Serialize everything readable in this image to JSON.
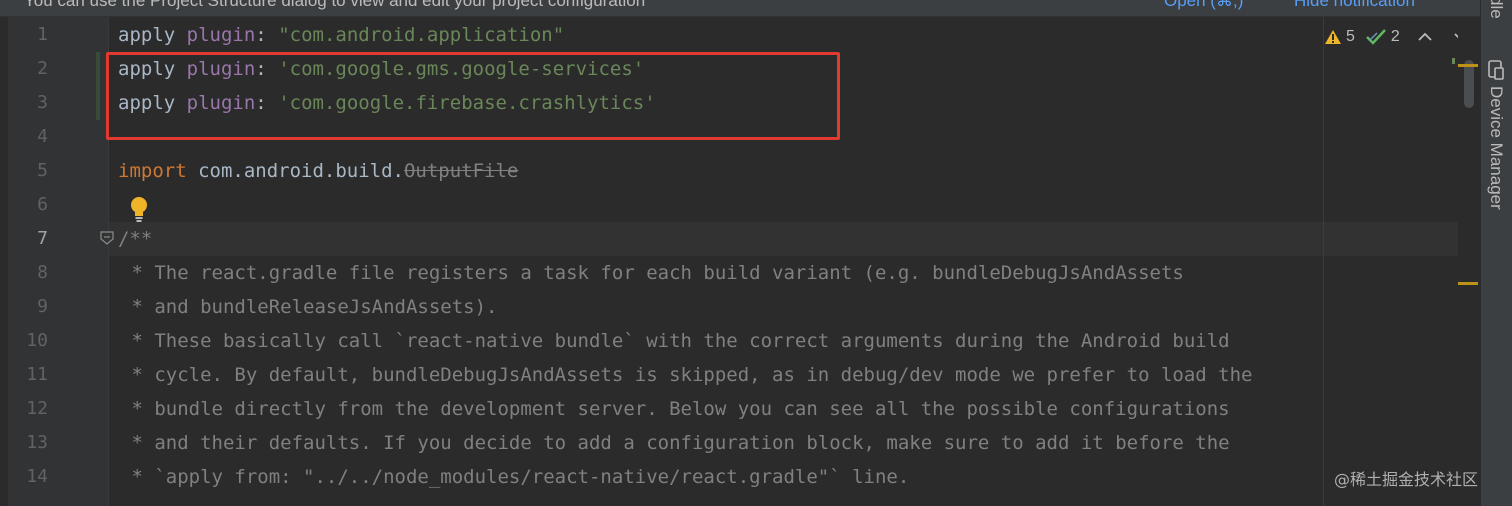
{
  "notification": {
    "message": "You can use the Project Structure dialog to view and edit your project configuration",
    "open_link": "Open (⌘;)",
    "hide_link": "Hide notification"
  },
  "side_panel": {
    "top_label": "dle",
    "device_manager_label": "Device Manager"
  },
  "inspections": {
    "warnings": "5",
    "weak_warnings": "2"
  },
  "line_numbers": [
    "1",
    "2",
    "3",
    "4",
    "5",
    "6",
    "7",
    "8",
    "9",
    "10",
    "11",
    "12",
    "13",
    "14"
  ],
  "code": {
    "l1": {
      "apply": "apply",
      "plugin": "plugin",
      "colon": ": ",
      "value": "\"com.android.application\""
    },
    "l2": {
      "apply": "apply",
      "plugin": "plugin",
      "colon": ": ",
      "value": "'com.google.gms.google-services'"
    },
    "l3": {
      "apply": "apply",
      "plugin": "plugin",
      "colon": ": ",
      "value": "'com.google.firebase.crashlytics'"
    },
    "l5": {
      "import": "import",
      "package": " com.android.build.",
      "cls": "OutputFile"
    },
    "l7": "/**",
    "l8": " * The react.gradle file registers a task for each build variant (e.g. bundleDebugJsAndAssets",
    "l9": " * and bundleReleaseJsAndAssets).",
    "l10": " * These basically call `react-native bundle` with the correct arguments during the Android build",
    "l11": " * cycle. By default, bundleDebugJsAndAssets is skipped, as in debug/dev mode we prefer to load the",
    "l12": " * bundle directly from the development server. Below you can see all the possible configurations",
    "l13": " * and their defaults. If you decide to add a configuration block, make sure to add it before the",
    "l14": " * `apply from: \"../../node_modules/react-native/react.gradle\"` line."
  },
  "watermark": "@稀土掘金技术社区",
  "colors": {
    "highlight_box": "#e23a2e",
    "keyword": "#cc7832",
    "string": "#6a8759",
    "plugin": "#9876aa",
    "comment": "#808080",
    "link": "#589df6"
  }
}
